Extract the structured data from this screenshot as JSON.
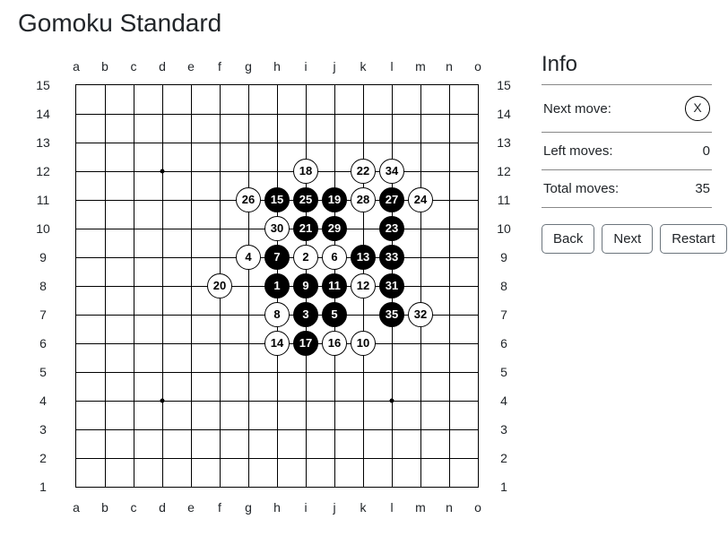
{
  "title": "Gomoku Standard",
  "info": {
    "heading": "Info",
    "next_move_label": "Next move:",
    "next_move_value": "X",
    "left_moves_label": "Left moves:",
    "left_moves_value": "0",
    "total_moves_label": "Total moves:",
    "total_moves_value": "35"
  },
  "buttons": {
    "back": "Back",
    "next": "Next",
    "restart": "Restart"
  },
  "board": {
    "size": 15,
    "columns": [
      "a",
      "b",
      "c",
      "d",
      "e",
      "f",
      "g",
      "h",
      "i",
      "j",
      "k",
      "l",
      "m",
      "n",
      "o"
    ],
    "star_points": [
      {
        "col": "d",
        "row": 12
      },
      {
        "col": "l",
        "row": 12
      },
      {
        "col": "h",
        "row": 8
      },
      {
        "col": "d",
        "row": 4
      },
      {
        "col": "l",
        "row": 4
      }
    ],
    "moves": [
      {
        "n": 1,
        "color": "black",
        "col": "h",
        "row": 8
      },
      {
        "n": 2,
        "color": "white",
        "col": "i",
        "row": 9
      },
      {
        "n": 3,
        "color": "black",
        "col": "i",
        "row": 7
      },
      {
        "n": 4,
        "color": "white",
        "col": "g",
        "row": 9
      },
      {
        "n": 5,
        "color": "black",
        "col": "j",
        "row": 7
      },
      {
        "n": 6,
        "color": "white",
        "col": "j",
        "row": 9
      },
      {
        "n": 7,
        "color": "black",
        "col": "h",
        "row": 9
      },
      {
        "n": 8,
        "color": "white",
        "col": "h",
        "row": 7
      },
      {
        "n": 9,
        "color": "black",
        "col": "i",
        "row": 8
      },
      {
        "n": 10,
        "color": "white",
        "col": "k",
        "row": 6
      },
      {
        "n": 11,
        "color": "black",
        "col": "j",
        "row": 8
      },
      {
        "n": 12,
        "color": "white",
        "col": "k",
        "row": 8
      },
      {
        "n": 13,
        "color": "black",
        "col": "k",
        "row": 9
      },
      {
        "n": 14,
        "color": "white",
        "col": "h",
        "row": 6
      },
      {
        "n": 15,
        "color": "black",
        "col": "h",
        "row": 11
      },
      {
        "n": 16,
        "color": "white",
        "col": "j",
        "row": 6
      },
      {
        "n": 17,
        "color": "black",
        "col": "i",
        "row": 6
      },
      {
        "n": 18,
        "color": "white",
        "col": "i",
        "row": 12
      },
      {
        "n": 19,
        "color": "black",
        "col": "j",
        "row": 11
      },
      {
        "n": 20,
        "color": "white",
        "col": "f",
        "row": 8
      },
      {
        "n": 21,
        "color": "black",
        "col": "i",
        "row": 10
      },
      {
        "n": 22,
        "color": "white",
        "col": "k",
        "row": 12
      },
      {
        "n": 23,
        "color": "black",
        "col": "l",
        "row": 10
      },
      {
        "n": 24,
        "color": "white",
        "col": "m",
        "row": 11
      },
      {
        "n": 25,
        "color": "black",
        "col": "i",
        "row": 11
      },
      {
        "n": 26,
        "color": "white",
        "col": "g",
        "row": 11
      },
      {
        "n": 27,
        "color": "black",
        "col": "l",
        "row": 11
      },
      {
        "n": 28,
        "color": "white",
        "col": "k",
        "row": 11
      },
      {
        "n": 29,
        "color": "black",
        "col": "j",
        "row": 10
      },
      {
        "n": 30,
        "color": "white",
        "col": "h",
        "row": 10
      },
      {
        "n": 31,
        "color": "black",
        "col": "l",
        "row": 8
      },
      {
        "n": 32,
        "color": "white",
        "col": "m",
        "row": 7
      },
      {
        "n": 33,
        "color": "black",
        "col": "l",
        "row": 9
      },
      {
        "n": 34,
        "color": "white",
        "col": "l",
        "row": 12
      },
      {
        "n": 35,
        "color": "black",
        "col": "l",
        "row": 7
      }
    ]
  }
}
